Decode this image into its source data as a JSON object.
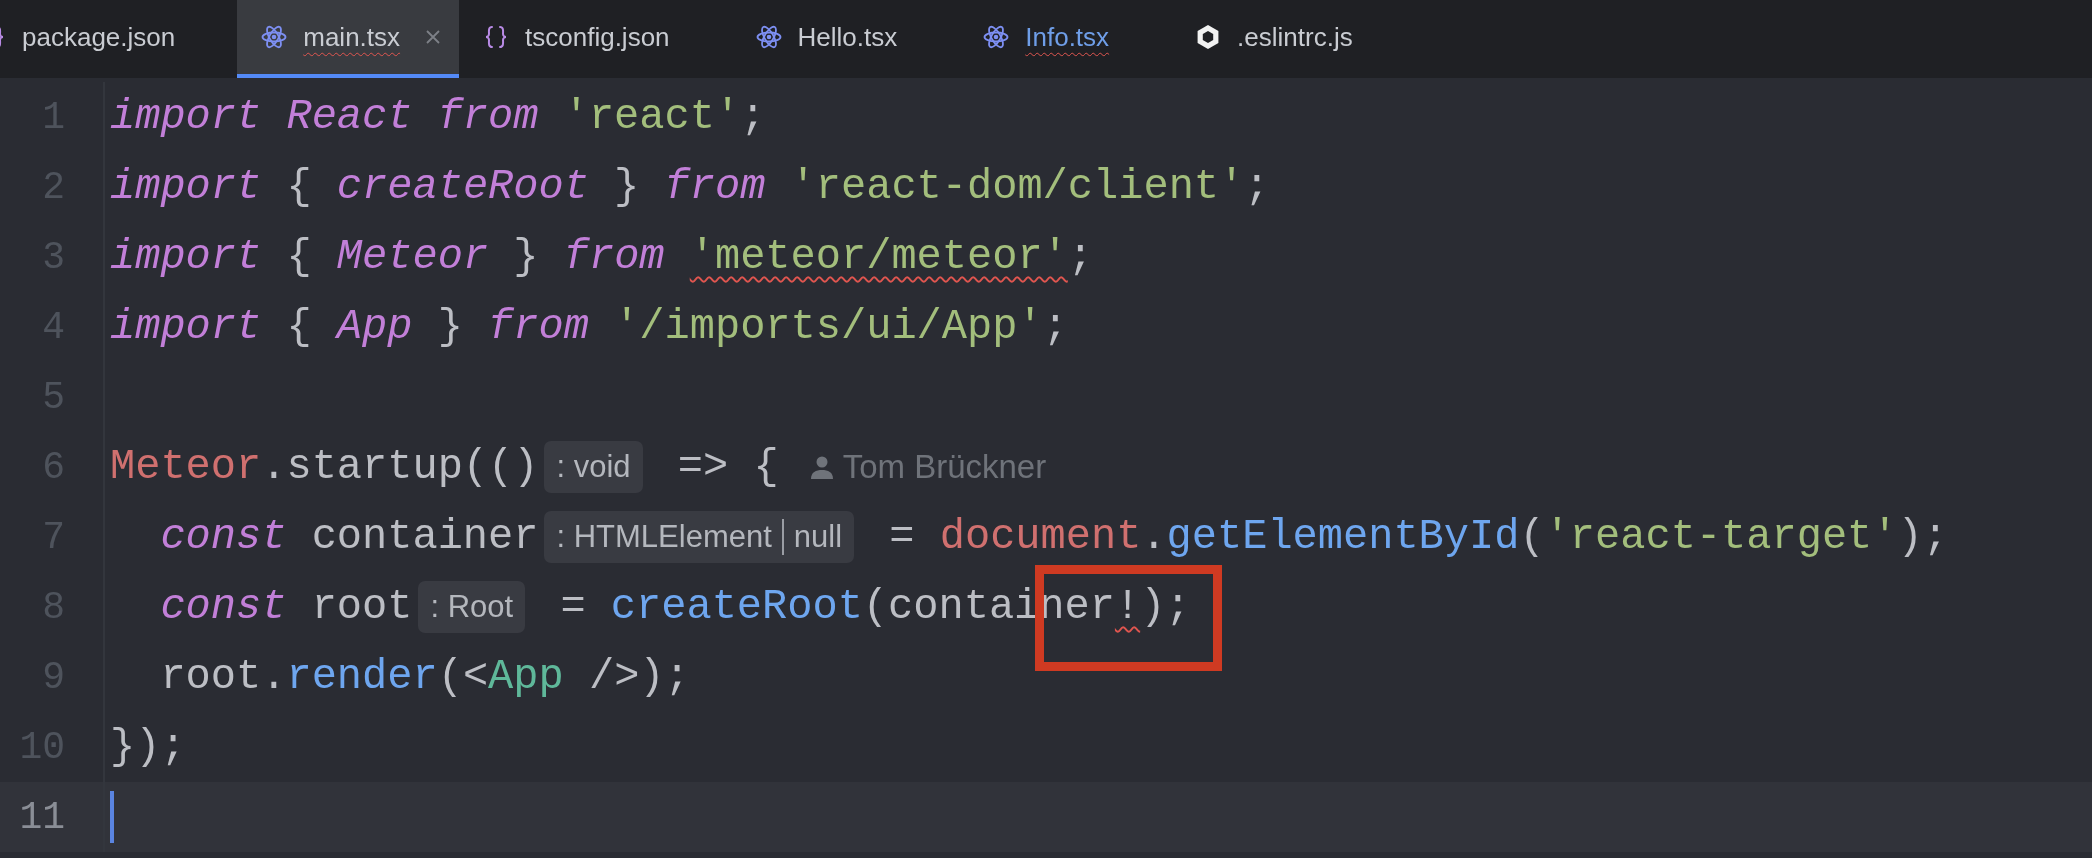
{
  "tabs": [
    {
      "label": "package.json",
      "kind": "braces",
      "selected": false,
      "error": false,
      "modified": false
    },
    {
      "label": "main.tsx",
      "kind": "react",
      "selected": true,
      "error": true,
      "modified": false
    },
    {
      "label": "tsconfig.json",
      "kind": "braces",
      "selected": false,
      "error": false,
      "modified": false
    },
    {
      "label": "Hello.tsx",
      "kind": "react",
      "selected": false,
      "error": false,
      "modified": false
    },
    {
      "label": "Info.tsx",
      "kind": "react",
      "selected": false,
      "error": true,
      "modified": true
    },
    {
      "label": ".eslintrc.js",
      "kind": "eslint",
      "selected": false,
      "error": false,
      "modified": false
    }
  ],
  "editor": {
    "lines": [
      {
        "number": "1",
        "current": false,
        "tokens": [
          {
            "kind": "kw",
            "text": "import React from"
          },
          {
            "kind": "str",
            "text": " 'react'"
          },
          {
            "kind": "plain",
            "text": ";"
          }
        ]
      },
      {
        "number": "2",
        "current": false,
        "tokens": [
          {
            "kind": "kw",
            "text": "import"
          },
          {
            "kind": "plain",
            "text": " { "
          },
          {
            "kind": "kw",
            "text": "createRoot"
          },
          {
            "kind": "plain",
            "text": " } "
          },
          {
            "kind": "kw",
            "text": "from"
          },
          {
            "kind": "str",
            "text": " 'react-dom/client'"
          },
          {
            "kind": "plain",
            "text": ";"
          }
        ]
      },
      {
        "number": "3",
        "current": false,
        "tokens": [
          {
            "kind": "kw",
            "text": "import"
          },
          {
            "kind": "plain",
            "text": " { "
          },
          {
            "kind": "kw",
            "text": "Meteor"
          },
          {
            "kind": "plain",
            "text": " } "
          },
          {
            "kind": "kw",
            "text": "from "
          },
          {
            "kind": "str",
            "text": "'meteor/meteor'",
            "error": true
          },
          {
            "kind": "plain",
            "text": ";"
          }
        ]
      },
      {
        "number": "4",
        "current": false,
        "tokens": [
          {
            "kind": "kw",
            "text": "import"
          },
          {
            "kind": "plain",
            "text": " { "
          },
          {
            "kind": "kw",
            "text": "App"
          },
          {
            "kind": "plain",
            "text": " } "
          },
          {
            "kind": "kw",
            "text": "from"
          },
          {
            "kind": "str",
            "text": " '/imports/ui/App'"
          },
          {
            "kind": "plain",
            "text": ";"
          }
        ]
      },
      {
        "number": "5",
        "current": false
      },
      {
        "number": "6",
        "current": false,
        "tokens": [
          {
            "kind": "global",
            "text": "Meteor"
          },
          {
            "kind": "plain",
            "text": ".startup(()"
          },
          {
            "kind": "hint",
            "parts": [
              ": void"
            ]
          },
          {
            "kind": "plain",
            "text": " => {"
          },
          {
            "kind": "author",
            "text": "Tom Brückner"
          }
        ]
      },
      {
        "number": "7",
        "current": false,
        "tokens": [
          {
            "kind": "kw",
            "text": "  const"
          },
          {
            "kind": "plain",
            "text": " container"
          },
          {
            "kind": "hint",
            "parts": [
              ": HTMLElement",
              "null"
            ]
          },
          {
            "kind": "plain",
            "text": " = "
          },
          {
            "kind": "global",
            "text": "document"
          },
          {
            "kind": "plain",
            "text": "."
          },
          {
            "kind": "fn",
            "text": "getElementById"
          },
          {
            "kind": "plain",
            "text": "("
          },
          {
            "kind": "str",
            "text": "'react-target'"
          },
          {
            "kind": "plain",
            "text": ");"
          }
        ]
      },
      {
        "number": "8",
        "current": false,
        "tokens": [
          {
            "kind": "kw",
            "text": "  const"
          },
          {
            "kind": "plain",
            "text": " root"
          },
          {
            "kind": "hint",
            "parts": [
              ": Root"
            ]
          },
          {
            "kind": "plain",
            "text": " = "
          },
          {
            "kind": "fn",
            "text": "createRoot"
          },
          {
            "kind": "plain",
            "text": "(container"
          },
          {
            "kind": "plain",
            "text": "!",
            "error": true,
            "annotated": true
          },
          {
            "kind": "plain",
            "text": ");"
          }
        ]
      },
      {
        "number": "9",
        "current": false,
        "tokens": [
          {
            "kind": "plain",
            "text": "  root."
          },
          {
            "kind": "fn",
            "text": "render"
          },
          {
            "kind": "plain",
            "text": "(<"
          },
          {
            "kind": "tag",
            "text": "App"
          },
          {
            "kind": "plain",
            "text": " />);"
          }
        ]
      },
      {
        "number": "10",
        "current": false,
        "tokens": [
          {
            "kind": "plain",
            "text": "});"
          }
        ]
      },
      {
        "number": "11",
        "current": true
      }
    ]
  }
}
